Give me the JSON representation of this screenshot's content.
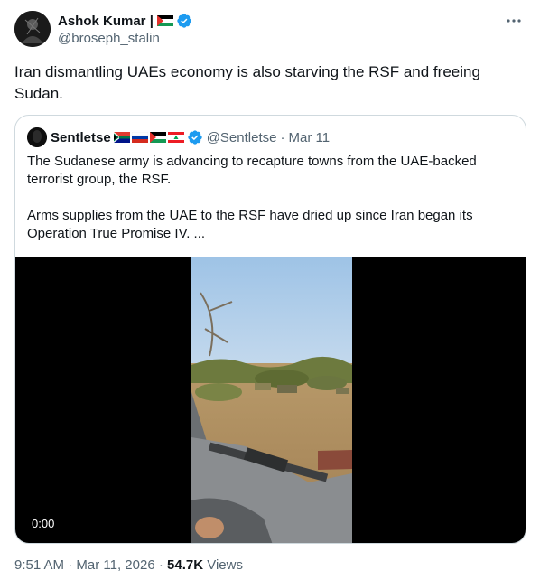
{
  "author": {
    "display_name": "Ashok Kumar |",
    "handle": "@broseph_stalin",
    "flag_icon": "palestine-flag-icon",
    "verified_icon": "verified-badge-icon",
    "verified_color": "#1d9bf0"
  },
  "tweet": {
    "text": "Iran dismantling UAEs economy is also starving the RSF and freeing Sudan."
  },
  "quote": {
    "display_name": "Sentletse",
    "flags": [
      "south-africa-flag-icon",
      "russia-flag-icon",
      "palestine-flag-icon",
      "lebanon-flag-icon"
    ],
    "handle": "@Sentletse",
    "separator": "·",
    "date": "Mar 11",
    "paragraph_1": "The Sudanese army is advancing to recapture towns from the UAE-backed terrorist group, the RSF.",
    "paragraph_2": "Arms supplies from the UAE to the RSF have dried up since Iran began its Operation True Promise IV. ..."
  },
  "video": {
    "timecode": "0:00"
  },
  "footer": {
    "time": "9:51 AM",
    "sep1": "·",
    "date": "Mar 11, 2026",
    "sep2": "·",
    "views_count": "54.7K",
    "views_label": "Views"
  },
  "colors": {
    "text_primary": "#0f1419",
    "text_secondary": "#536471",
    "border": "#cfd9de",
    "accent": "#1d9bf0"
  }
}
